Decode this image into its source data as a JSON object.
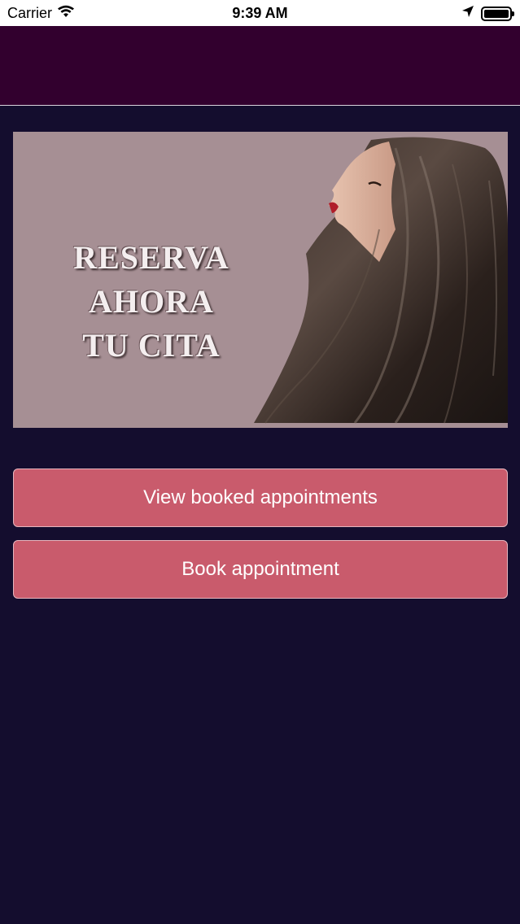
{
  "status_bar": {
    "carrier": "Carrier",
    "time": "9:39 AM",
    "icons": [
      "wifi-icon",
      "location-arrow-icon",
      "battery-icon"
    ]
  },
  "banner": {
    "line1": "RESERVA AHORA",
    "line2": "TU CITA",
    "image": "woman-long-hair-profile"
  },
  "buttons": {
    "view_booked": "View booked appointments",
    "book": "Book appointment"
  },
  "colors": {
    "nav": "#32002e",
    "background": "#140d2e",
    "button": "#c95b6c",
    "banner_bg": "#a68f94"
  }
}
